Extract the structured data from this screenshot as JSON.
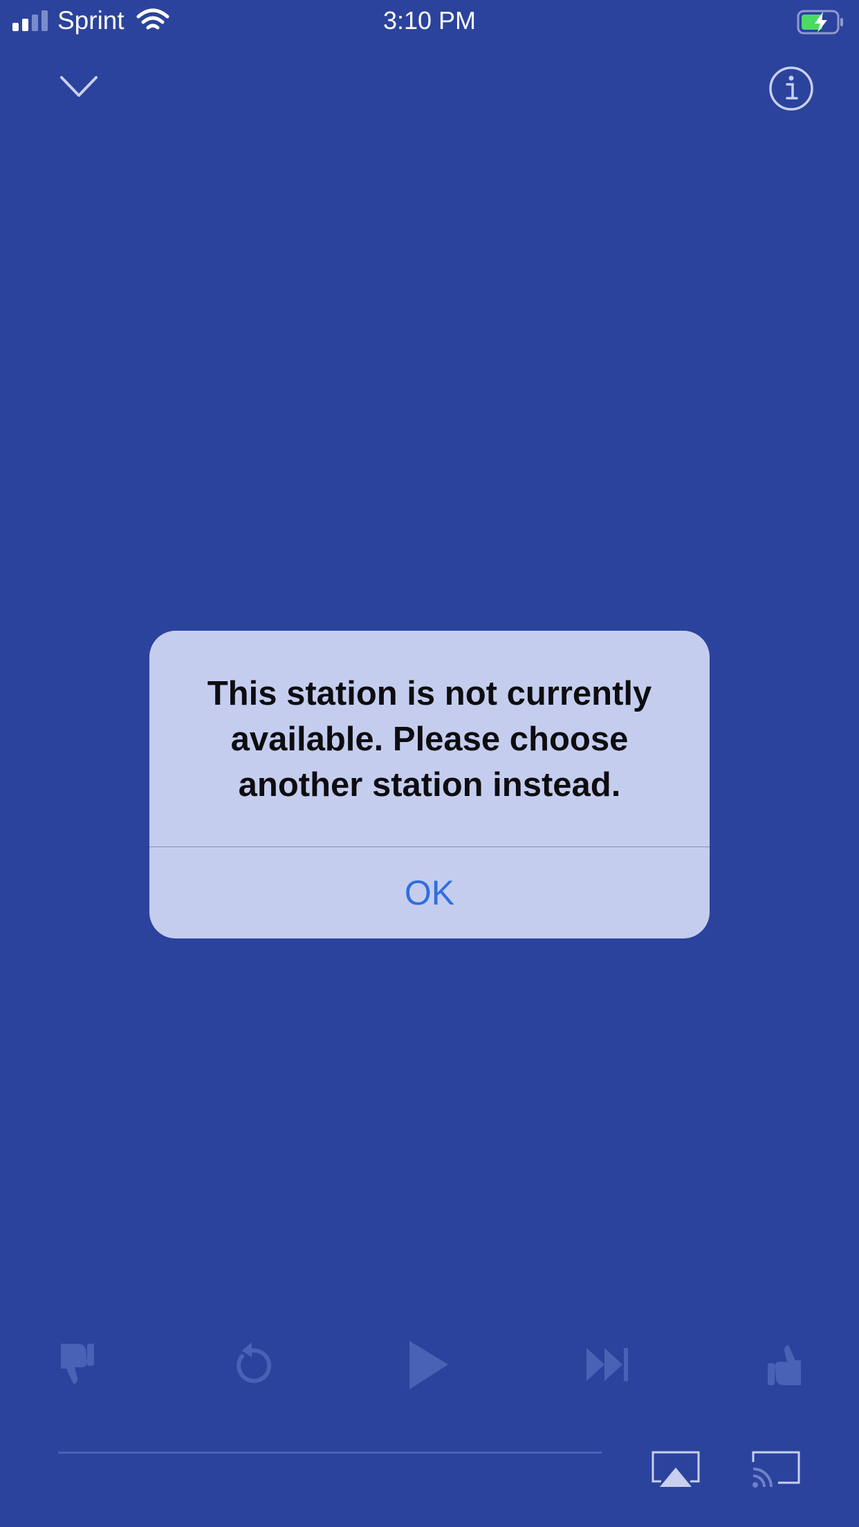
{
  "status_bar": {
    "carrier": "Sprint",
    "time": "3:10 PM",
    "icons": [
      "signal-icon",
      "wifi-icon",
      "battery-charging-icon"
    ]
  },
  "header": {
    "icons": [
      "chevron-down-icon",
      "info-icon"
    ]
  },
  "alert": {
    "message": "This station is not currently available. Please choose another station instead.",
    "ok_label": "OK"
  },
  "player_controls": {
    "icons": [
      "thumbs-down-icon",
      "replay-icon",
      "play-icon",
      "skip-forward-icon",
      "thumbs-up-icon",
      "airplay-icon",
      "cast-icon"
    ]
  },
  "colors": {
    "background": "#2b439c",
    "alert_background": "#c5cdef",
    "alert_button": "#2f6fe0",
    "dimmed_control": "#4a62b5"
  }
}
